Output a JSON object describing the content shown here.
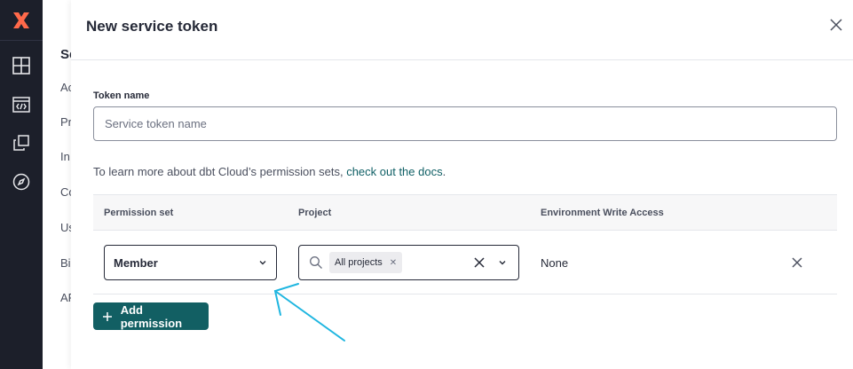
{
  "background_page": {
    "heading": "Se",
    "items": [
      "Ac",
      "Pr",
      "In",
      "Co",
      "Us",
      "Bi",
      "AF"
    ]
  },
  "drawer": {
    "title": "New service token",
    "token_name": {
      "label": "Token name",
      "placeholder": "Service token name",
      "value": ""
    },
    "help": {
      "prefix": "To learn more about dbt Cloud’s permission sets, ",
      "link": "check out the docs",
      "suffix": "."
    },
    "permissions_table": {
      "headers": [
        "Permission set",
        "Project",
        "Environment Write Access"
      ],
      "rows": [
        {
          "permission_set": "Member",
          "project_chip": "All projects",
          "environment_write_access": "None"
        }
      ]
    },
    "add_button_label": "Add permission"
  },
  "colors": {
    "rail": "#1c1f2a",
    "logo": "#ff694a",
    "accent": "#125f63",
    "link": "#0f5f65",
    "annotation_arrow": "#1fb6e0"
  },
  "icons": {
    "rail": [
      "dbt-logo-icon",
      "grid-layout-icon",
      "code-icon",
      "copy-icon",
      "compass-icon"
    ],
    "close": "close-icon",
    "search": "search-icon",
    "chevron": "chevron-down-icon",
    "add": "plus-icon"
  }
}
